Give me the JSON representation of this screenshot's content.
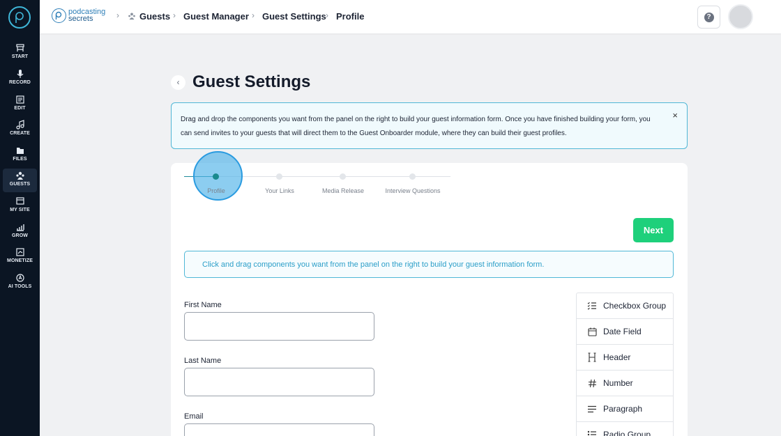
{
  "brand": {
    "line1": "podcasting",
    "line2": "secrets"
  },
  "sidebar": {
    "items": [
      {
        "label": "START",
        "icon": "start-icon"
      },
      {
        "label": "RECORD",
        "icon": "mic-icon"
      },
      {
        "label": "EDIT",
        "icon": "edit-icon"
      },
      {
        "label": "CREATE",
        "icon": "music-note-icon"
      },
      {
        "label": "FILES",
        "icon": "files-icon"
      },
      {
        "label": "GUESTS",
        "icon": "guests-icon",
        "active": true
      },
      {
        "label": "MY SITE",
        "icon": "site-icon"
      },
      {
        "label": "GROW",
        "icon": "growth-chart-icon"
      },
      {
        "label": "MONETIZE",
        "icon": "monetize-icon"
      },
      {
        "label": "AI TOOLS",
        "icon": "ai-tools-icon"
      }
    ]
  },
  "breadcrumb": [
    "Guests",
    "Guest Manager",
    "Guest Settings",
    "Profile"
  ],
  "page": {
    "title": "Guest Settings",
    "info": "Drag and drop the components you want from the panel on the right to build your guest information form. Once you have finished building your form, you can send invites to your guests that will direct them to the Guest Onboarder module, where they can build their guest profiles.",
    "close": "×"
  },
  "steps": [
    "Profile",
    "Your Links",
    "Media Release",
    "Interview Questions"
  ],
  "active_step": "Profile",
  "next_label": "Next",
  "drag_hint": "Click and drag components you want from the panel on the right to build your guest information form.",
  "fields": [
    "First Name",
    "Last Name",
    "Email"
  ],
  "components": [
    {
      "label": "Checkbox Group",
      "icon": "checklist-icon"
    },
    {
      "label": "Date Field",
      "icon": "calendar-icon"
    },
    {
      "label": "Header",
      "icon": "header-icon"
    },
    {
      "label": "Number",
      "icon": "hash-icon"
    },
    {
      "label": "Paragraph",
      "icon": "paragraph-icon"
    },
    {
      "label": "Radio Group",
      "icon": "radio-list-icon"
    }
  ],
  "colors": {
    "sidebar_bg": "#0b1523",
    "accent": "#4fb7d6",
    "next_green": "#1ed07b",
    "step_active": "#1a8a8e"
  }
}
